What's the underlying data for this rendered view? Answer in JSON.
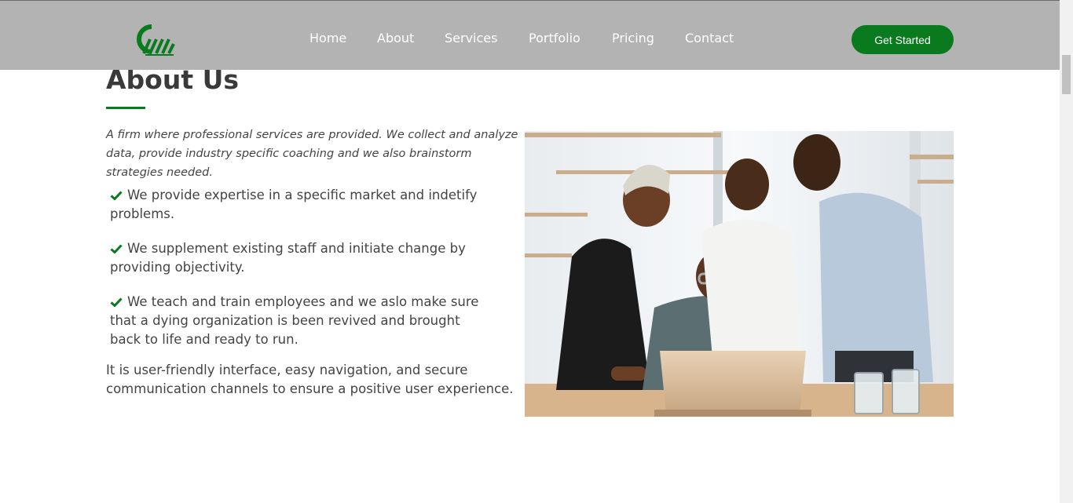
{
  "header": {
    "nav": [
      "Home",
      "About",
      "Services",
      "Portfolio",
      "Pricing",
      "Contact"
    ],
    "cta_label": "Get Started"
  },
  "about": {
    "title": "About Us",
    "intro": "A firm where professional services are provided. We collect and analyze data, provide industry specific coaching and we also brainstorm strategies needed.",
    "features": [
      "We provide expertise in a specific market and indetify problems.",
      "We supplement existing staff and initiate change by providing objectivity.",
      "We teach and train employees and we aslo make sure that a dying organization is been revived and brought back to life and ready to run."
    ],
    "closing": "It is user-friendly interface, easy navigation, and secure communication channels to ensure a positive user experience."
  },
  "colors": {
    "brand_green": "#0a7a1f",
    "header_bg": "#b3b3b3",
    "text": "#444444"
  },
  "icons": {
    "feature_bullet": "check-icon",
    "logo": "cw-logo"
  }
}
